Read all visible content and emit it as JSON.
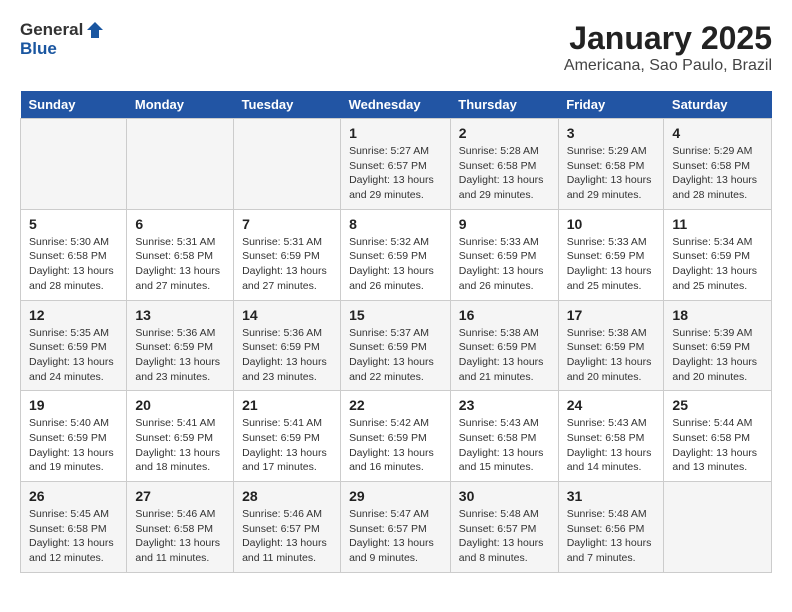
{
  "header": {
    "logo_general": "General",
    "logo_blue": "Blue",
    "month": "January 2025",
    "location": "Americana, Sao Paulo, Brazil"
  },
  "days_of_week": [
    "Sunday",
    "Monday",
    "Tuesday",
    "Wednesday",
    "Thursday",
    "Friday",
    "Saturday"
  ],
  "weeks": [
    [
      {
        "day": "",
        "info": ""
      },
      {
        "day": "",
        "info": ""
      },
      {
        "day": "",
        "info": ""
      },
      {
        "day": "1",
        "info": "Sunrise: 5:27 AM\nSunset: 6:57 PM\nDaylight: 13 hours\nand 29 minutes."
      },
      {
        "day": "2",
        "info": "Sunrise: 5:28 AM\nSunset: 6:58 PM\nDaylight: 13 hours\nand 29 minutes."
      },
      {
        "day": "3",
        "info": "Sunrise: 5:29 AM\nSunset: 6:58 PM\nDaylight: 13 hours\nand 29 minutes."
      },
      {
        "day": "4",
        "info": "Sunrise: 5:29 AM\nSunset: 6:58 PM\nDaylight: 13 hours\nand 28 minutes."
      }
    ],
    [
      {
        "day": "5",
        "info": "Sunrise: 5:30 AM\nSunset: 6:58 PM\nDaylight: 13 hours\nand 28 minutes."
      },
      {
        "day": "6",
        "info": "Sunrise: 5:31 AM\nSunset: 6:58 PM\nDaylight: 13 hours\nand 27 minutes."
      },
      {
        "day": "7",
        "info": "Sunrise: 5:31 AM\nSunset: 6:59 PM\nDaylight: 13 hours\nand 27 minutes."
      },
      {
        "day": "8",
        "info": "Sunrise: 5:32 AM\nSunset: 6:59 PM\nDaylight: 13 hours\nand 26 minutes."
      },
      {
        "day": "9",
        "info": "Sunrise: 5:33 AM\nSunset: 6:59 PM\nDaylight: 13 hours\nand 26 minutes."
      },
      {
        "day": "10",
        "info": "Sunrise: 5:33 AM\nSunset: 6:59 PM\nDaylight: 13 hours\nand 25 minutes."
      },
      {
        "day": "11",
        "info": "Sunrise: 5:34 AM\nSunset: 6:59 PM\nDaylight: 13 hours\nand 25 minutes."
      }
    ],
    [
      {
        "day": "12",
        "info": "Sunrise: 5:35 AM\nSunset: 6:59 PM\nDaylight: 13 hours\nand 24 minutes."
      },
      {
        "day": "13",
        "info": "Sunrise: 5:36 AM\nSunset: 6:59 PM\nDaylight: 13 hours\nand 23 minutes."
      },
      {
        "day": "14",
        "info": "Sunrise: 5:36 AM\nSunset: 6:59 PM\nDaylight: 13 hours\nand 23 minutes."
      },
      {
        "day": "15",
        "info": "Sunrise: 5:37 AM\nSunset: 6:59 PM\nDaylight: 13 hours\nand 22 minutes."
      },
      {
        "day": "16",
        "info": "Sunrise: 5:38 AM\nSunset: 6:59 PM\nDaylight: 13 hours\nand 21 minutes."
      },
      {
        "day": "17",
        "info": "Sunrise: 5:38 AM\nSunset: 6:59 PM\nDaylight: 13 hours\nand 20 minutes."
      },
      {
        "day": "18",
        "info": "Sunrise: 5:39 AM\nSunset: 6:59 PM\nDaylight: 13 hours\nand 20 minutes."
      }
    ],
    [
      {
        "day": "19",
        "info": "Sunrise: 5:40 AM\nSunset: 6:59 PM\nDaylight: 13 hours\nand 19 minutes."
      },
      {
        "day": "20",
        "info": "Sunrise: 5:41 AM\nSunset: 6:59 PM\nDaylight: 13 hours\nand 18 minutes."
      },
      {
        "day": "21",
        "info": "Sunrise: 5:41 AM\nSunset: 6:59 PM\nDaylight: 13 hours\nand 17 minutes."
      },
      {
        "day": "22",
        "info": "Sunrise: 5:42 AM\nSunset: 6:59 PM\nDaylight: 13 hours\nand 16 minutes."
      },
      {
        "day": "23",
        "info": "Sunrise: 5:43 AM\nSunset: 6:58 PM\nDaylight: 13 hours\nand 15 minutes."
      },
      {
        "day": "24",
        "info": "Sunrise: 5:43 AM\nSunset: 6:58 PM\nDaylight: 13 hours\nand 14 minutes."
      },
      {
        "day": "25",
        "info": "Sunrise: 5:44 AM\nSunset: 6:58 PM\nDaylight: 13 hours\nand 13 minutes."
      }
    ],
    [
      {
        "day": "26",
        "info": "Sunrise: 5:45 AM\nSunset: 6:58 PM\nDaylight: 13 hours\nand 12 minutes."
      },
      {
        "day": "27",
        "info": "Sunrise: 5:46 AM\nSunset: 6:58 PM\nDaylight: 13 hours\nand 11 minutes."
      },
      {
        "day": "28",
        "info": "Sunrise: 5:46 AM\nSunset: 6:57 PM\nDaylight: 13 hours\nand 11 minutes."
      },
      {
        "day": "29",
        "info": "Sunrise: 5:47 AM\nSunset: 6:57 PM\nDaylight: 13 hours\nand 9 minutes."
      },
      {
        "day": "30",
        "info": "Sunrise: 5:48 AM\nSunset: 6:57 PM\nDaylight: 13 hours\nand 8 minutes."
      },
      {
        "day": "31",
        "info": "Sunrise: 5:48 AM\nSunset: 6:56 PM\nDaylight: 13 hours\nand 7 minutes."
      },
      {
        "day": "",
        "info": ""
      }
    ]
  ]
}
